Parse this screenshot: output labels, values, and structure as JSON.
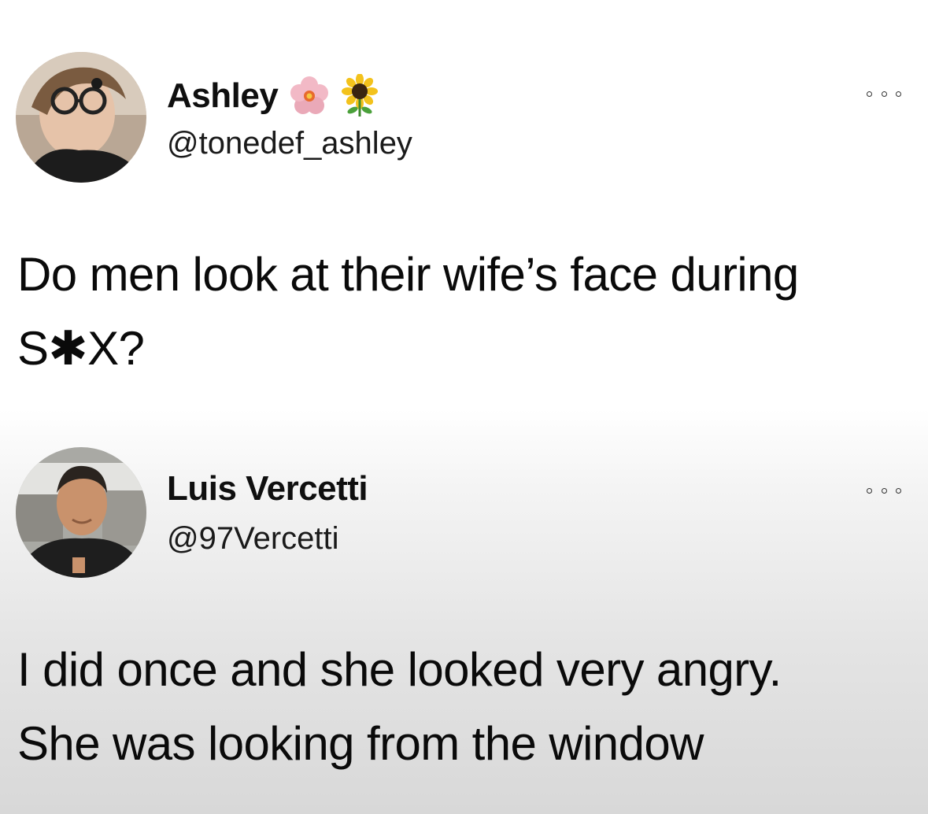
{
  "tweets": [
    {
      "display_name": "Ashley",
      "handle": "@tonedef_ashley",
      "name_emojis": [
        "pink-flower-icon",
        "sunflower-icon"
      ],
      "text": "Do men look at their wife’s face during\nS✱X?"
    },
    {
      "display_name": "Luis Vercetti",
      "handle": "@97Vercetti",
      "name_emojis": [],
      "text": "I did once and she looked very angry.\nShe was looking from the window"
    }
  ],
  "colors": {
    "text": "#0a0a0a",
    "background_top": "#ffffff",
    "background_bottom": "#d8d8d8"
  }
}
